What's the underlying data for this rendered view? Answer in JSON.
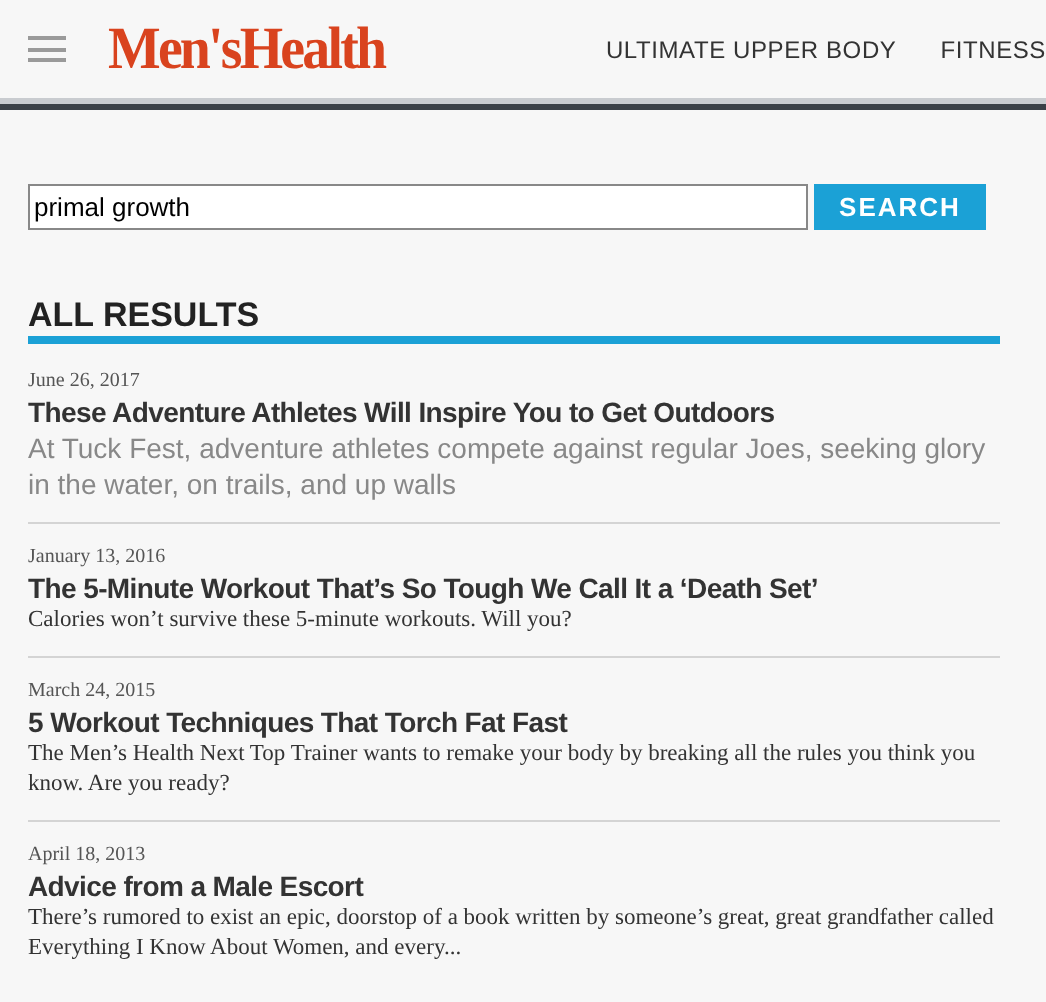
{
  "header": {
    "logo": "Men'sHealth",
    "nav": [
      "ULTIMATE UPPER BODY",
      "FITNESS"
    ]
  },
  "search": {
    "value": "primal growth",
    "button": "SEARCH"
  },
  "results_heading": "ALL RESULTS",
  "results": [
    {
      "kind": "lead",
      "date": "June 26, 2017",
      "title": "These Adventure Athletes Will Inspire You to Get Outdoors",
      "summary": "At Tuck Fest, adventure athletes compete against regular Joes, seeking glory in the water, on trails, and up walls"
    },
    {
      "kind": "plain",
      "date": "January 13, 2016",
      "title": "The 5-Minute Workout That’s So Tough We Call It a ‘Death Set’",
      "summary": "Calories won’t survive these 5-minute workouts. Will you?"
    },
    {
      "kind": "plain",
      "date": "March 24, 2015",
      "title": "5 Workout Techniques That Torch Fat Fast",
      "summary": "The Men’s Health Next Top Trainer wants to remake your body by breaking all the rules you think you know. Are you ready?"
    },
    {
      "kind": "plain",
      "date": "April 18, 2013",
      "title": "Advice from a Male Escort",
      "summary": "There’s rumored to exist an epic, doorstop of a book written by someone’s great, great grandfather called Everything I Know About Women, and every..."
    }
  ]
}
